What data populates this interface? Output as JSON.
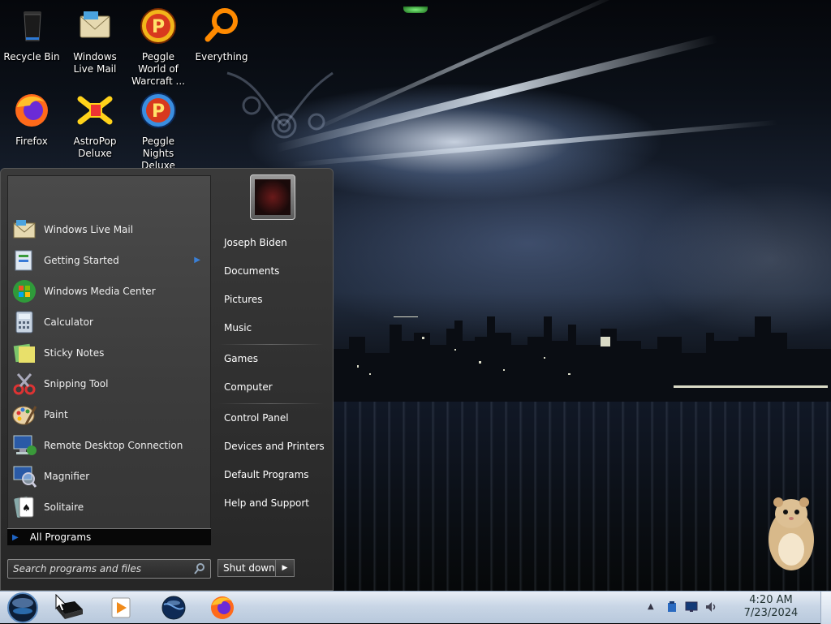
{
  "desktop": {
    "icons": [
      {
        "label": "Recycle Bin",
        "icon": "recycle-bin-icon"
      },
      {
        "label": "Windows Live Mail",
        "icon": "windows-live-mail-icon"
      },
      {
        "label": "Peggle World of Warcraft ...",
        "icon": "peggle-icon"
      },
      {
        "label": "Everything",
        "icon": "magnifier-search-icon"
      },
      {
        "label": "Firefox",
        "icon": "firefox-icon"
      },
      {
        "label": "AstroPop Deluxe",
        "icon": "astropop-icon"
      },
      {
        "label": "Peggle Nights Deluxe",
        "icon": "peggle-nights-icon"
      }
    ]
  },
  "start_menu": {
    "programs": [
      {
        "label": "Windows Live Mail",
        "icon": "mail-icon"
      },
      {
        "label": "Getting Started",
        "icon": "getting-started-icon",
        "submenu": true
      },
      {
        "label": "Windows Media Center",
        "icon": "media-center-icon"
      },
      {
        "label": "Calculator",
        "icon": "calculator-icon"
      },
      {
        "label": "Sticky Notes",
        "icon": "sticky-notes-icon"
      },
      {
        "label": "Snipping Tool",
        "icon": "scissors-icon"
      },
      {
        "label": "Paint",
        "icon": "paint-palette-icon"
      },
      {
        "label": "Remote Desktop Connection",
        "icon": "remote-desktop-icon"
      },
      {
        "label": "Magnifier",
        "icon": "magnifier-icon"
      },
      {
        "label": "Solitaire",
        "icon": "cards-icon"
      }
    ],
    "all_programs": "All Programs",
    "search_placeholder": "Search programs and files",
    "user_links": [
      {
        "label": "Joseph Biden"
      },
      {
        "label": "Documents"
      },
      {
        "label": "Pictures"
      },
      {
        "label": "Music"
      },
      {
        "label": "Games"
      },
      {
        "label": "Computer"
      },
      {
        "label": "Control Panel"
      },
      {
        "label": "Devices and Printers"
      },
      {
        "label": "Default Programs"
      },
      {
        "label": "Help and Support"
      }
    ],
    "shutdown_label": "Shut down"
  },
  "taskbar": {
    "pinned": [
      "start-orb-icon",
      "printer-icon",
      "media-player-icon",
      "globe-icon",
      "firefox-icon"
    ],
    "clock_time": "4:20 AM",
    "clock_date": "7/23/2024"
  }
}
